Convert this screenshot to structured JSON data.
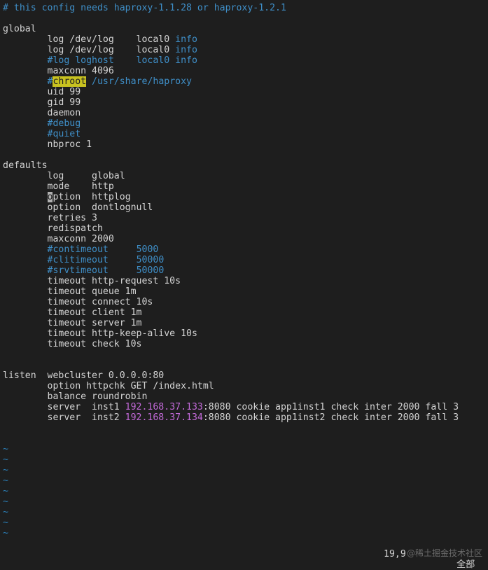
{
  "editor": {
    "lines": [
      [
        {
          "t": "# this config needs haproxy-1.1.28 or haproxy-1.2.1",
          "c": "comment"
        }
      ],
      [],
      [
        {
          "t": "global",
          "c": "plain"
        }
      ],
      [
        {
          "t": "        log /dev/log    local0 ",
          "c": "plain"
        },
        {
          "t": "info",
          "c": "blue"
        }
      ],
      [
        {
          "t": "        log /dev/log    local0 ",
          "c": "plain"
        },
        {
          "t": "info",
          "c": "blue"
        }
      ],
      [
        {
          "t": "        #log loghost    local0 info",
          "c": "comment"
        }
      ],
      [
        {
          "t": "        maxconn 4096",
          "c": "plain"
        }
      ],
      [
        {
          "t": "        #",
          "c": "comment"
        },
        {
          "t": "chroot",
          "c": "hl"
        },
        {
          "t": " /usr/share/haproxy",
          "c": "comment"
        }
      ],
      [
        {
          "t": "        uid 99",
          "c": "plain"
        }
      ],
      [
        {
          "t": "        gid 99",
          "c": "plain"
        }
      ],
      [
        {
          "t": "        daemon",
          "c": "plain"
        }
      ],
      [
        {
          "t": "        #debug",
          "c": "comment"
        }
      ],
      [
        {
          "t": "        #quiet",
          "c": "comment"
        }
      ],
      [
        {
          "t": "        nbproc 1",
          "c": "plain"
        }
      ],
      [],
      [
        {
          "t": "defaults",
          "c": "plain"
        }
      ],
      [
        {
          "t": "        log     global",
          "c": "plain"
        }
      ],
      [
        {
          "t": "        mode    http",
          "c": "plain"
        }
      ],
      [
        {
          "t": "        ",
          "c": "plain"
        },
        {
          "t": "o",
          "c": "cursor"
        },
        {
          "t": "ption  httplog",
          "c": "plain"
        }
      ],
      [
        {
          "t": "        option  dontlognull",
          "c": "plain"
        }
      ],
      [
        {
          "t": "        retries 3",
          "c": "plain"
        }
      ],
      [
        {
          "t": "        redispatch",
          "c": "plain"
        }
      ],
      [
        {
          "t": "        maxconn 2000",
          "c": "plain"
        }
      ],
      [
        {
          "t": "        #contimeout     ",
          "c": "comment"
        },
        {
          "t": "5000",
          "c": "blue"
        }
      ],
      [
        {
          "t": "        #clitimeout     ",
          "c": "comment"
        },
        {
          "t": "50000",
          "c": "blue"
        }
      ],
      [
        {
          "t": "        #srvtimeout     ",
          "c": "comment"
        },
        {
          "t": "50000",
          "c": "blue"
        }
      ],
      [
        {
          "t": "        timeout http-request 10s",
          "c": "plain"
        }
      ],
      [
        {
          "t": "        timeout queue 1m",
          "c": "plain"
        }
      ],
      [
        {
          "t": "        timeout connect 10s",
          "c": "plain"
        }
      ],
      [
        {
          "t": "        timeout client 1m",
          "c": "plain"
        }
      ],
      [
        {
          "t": "        timeout server 1m",
          "c": "plain"
        }
      ],
      [
        {
          "t": "        timeout http-keep-alive 10s",
          "c": "plain"
        }
      ],
      [
        {
          "t": "        timeout check 10s",
          "c": "plain"
        }
      ],
      [],
      [],
      [
        {
          "t": "listen  webcluster 0.0.0.0:80",
          "c": "plain"
        }
      ],
      [
        {
          "t": "        option httpchk GET /index.html",
          "c": "plain"
        }
      ],
      [
        {
          "t": "        balance roundrobin",
          "c": "plain"
        }
      ],
      [
        {
          "t": "        server  inst1 ",
          "c": "plain"
        },
        {
          "t": "192.168.37.133",
          "c": "magenta"
        },
        {
          "t": ":8080 cookie app1inst1 check inter 2000 fall 3",
          "c": "plain"
        }
      ],
      [
        {
          "t": "        server  inst2 ",
          "c": "plain"
        },
        {
          "t": "192.168.37.134",
          "c": "magenta"
        },
        {
          "t": ":8080 cookie app1inst2 check inter 2000 fall 3",
          "c": "plain"
        }
      ],
      [],
      [],
      [
        {
          "t": "~",
          "c": "tilde"
        }
      ],
      [
        {
          "t": "~",
          "c": "tilde"
        }
      ],
      [
        {
          "t": "~",
          "c": "tilde"
        }
      ],
      [
        {
          "t": "~",
          "c": "tilde"
        }
      ],
      [
        {
          "t": "~",
          "c": "tilde"
        }
      ],
      [
        {
          "t": "~",
          "c": "tilde"
        }
      ],
      [
        {
          "t": "~",
          "c": "tilde"
        }
      ],
      [
        {
          "t": "~",
          "c": "tilde"
        }
      ],
      [
        {
          "t": "~",
          "c": "tilde"
        }
      ]
    ]
  },
  "status": {
    "cursor_position": "19,9",
    "scroll_position": "全部"
  },
  "watermark": "@稀土掘金技术社区",
  "colors": {
    "background": "#1e1e1e",
    "text": "#d4d4d4",
    "comment": "#3f8fc8",
    "ip_address": "#c36ad9",
    "search_highlight": "#c8c220",
    "tilde": "#2b7fb8"
  }
}
